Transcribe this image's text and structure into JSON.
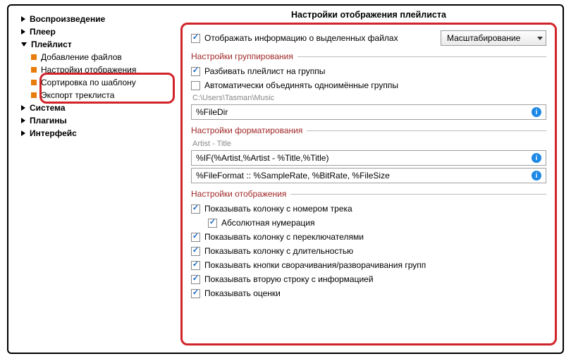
{
  "sidebar": {
    "items": [
      {
        "label": "Воспроизведение",
        "type": "top",
        "arrow": "r"
      },
      {
        "label": "Плеер",
        "type": "top",
        "arrow": "r"
      },
      {
        "label": "Плейлист",
        "type": "top",
        "arrow": "d"
      },
      {
        "label": "Добавление файлов",
        "type": "child"
      },
      {
        "label": "Настройки отображения",
        "type": "child"
      },
      {
        "label": "Сортировка по шаблону",
        "type": "child"
      },
      {
        "label": "Экспорт треклиста",
        "type": "child"
      },
      {
        "label": "Система",
        "type": "top",
        "arrow": "r"
      },
      {
        "label": "Плагины",
        "type": "top",
        "arrow": "r"
      },
      {
        "label": "Интерфейс",
        "type": "top",
        "arrow": "r"
      }
    ]
  },
  "title": "Настройки отображения плейлиста",
  "top": {
    "show_selected": "Отображать информацию о выделенных файлах",
    "scale_select": "Масштабирование"
  },
  "group": {
    "legend": "Настройки группирования",
    "split": "Разбивать плейлист на группы",
    "merge": "Автоматически объединять одноимённые группы",
    "path_hint": "C:\\Users\\Tasman\\Music",
    "template": "%FileDir"
  },
  "format": {
    "legend": "Настройки форматирования",
    "hint": "Artist - Title",
    "line1": "%IF(%Artist,%Artist - %Title,%Title)",
    "line2": "%FileFormat :: %SampleRate, %BitRate, %FileSize"
  },
  "display": {
    "legend": "Настройки отображения",
    "c1": "Показывать колонку с номером трека",
    "c1a": "Абсолютная нумерация",
    "c2": "Показывать колонку с переключателями",
    "c3": "Показывать колонку с длительностью",
    "c4": "Показывать кнопки сворачивания/разворачивания групп",
    "c5": "Показывать вторую строку с информацией",
    "c6": "Показывать оценки"
  }
}
